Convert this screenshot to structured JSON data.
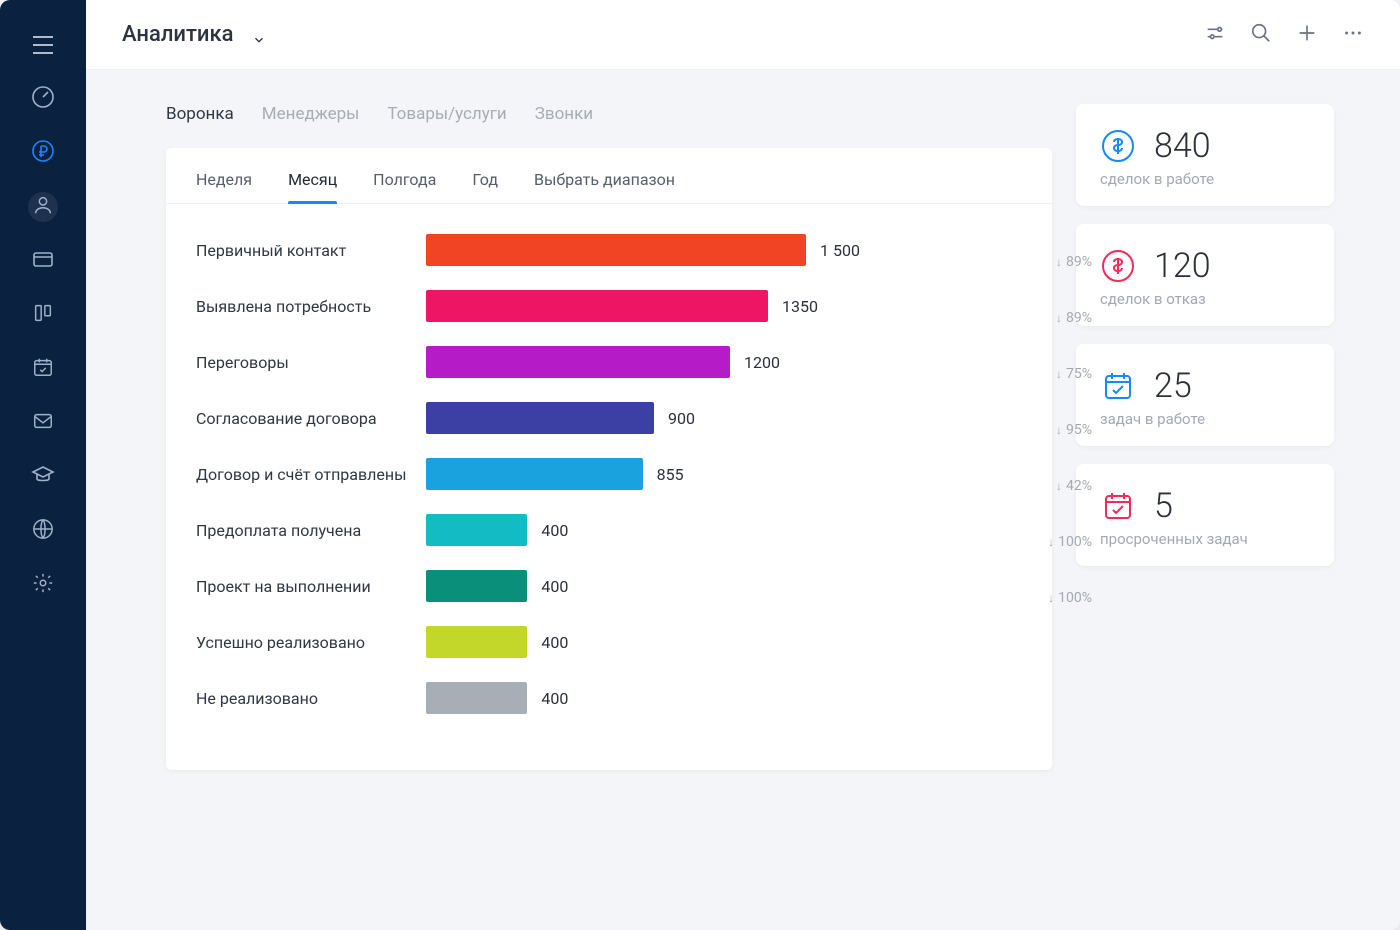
{
  "page_title": "Аналитика",
  "top_tabs": [
    "Воронка",
    "Менеджеры",
    "Товары/услуги",
    "Звонки"
  ],
  "top_tab_active": 0,
  "period_tabs": [
    "Неделя",
    "Месяц",
    "Полгода",
    "Год",
    "Выбрать диапазон"
  ],
  "period_tab_active": 1,
  "chart_data": {
    "type": "bar",
    "title": "",
    "xlabel": "",
    "ylabel": "",
    "max_value": 1500,
    "series": [
      {
        "name": "Первичный контакт",
        "value": 1500,
        "value_label": "1 500",
        "color": "#f14425",
        "drop_pct": "89%"
      },
      {
        "name": "Выявлена потребность",
        "value": 1350,
        "value_label": "1350",
        "color": "#ee1565",
        "drop_pct": "89%"
      },
      {
        "name": "Переговоры",
        "value": 1200,
        "value_label": "1200",
        "color": "#b51cc7",
        "drop_pct": "75%"
      },
      {
        "name": "Согласование договора",
        "value": 900,
        "value_label": "900",
        "color": "#3c3fa4",
        "drop_pct": "95%"
      },
      {
        "name": "Договор и счёт отправлены",
        "value": 855,
        "value_label": "855",
        "color": "#1aa2df",
        "drop_pct": "42%"
      },
      {
        "name": "Предоплата получена",
        "value": 400,
        "value_label": "400",
        "color": "#13bcc5",
        "drop_pct": "100%"
      },
      {
        "name": "Проект на выполнении",
        "value": 400,
        "value_label": "400",
        "color": "#0a8f7b",
        "drop_pct": "100%"
      },
      {
        "name": "Успешно реализовано",
        "value": 400,
        "value_label": "400",
        "color": "#c3d62a",
        "drop_pct": null
      },
      {
        "name": "Не реализовано",
        "value": 400,
        "value_label": "400",
        "color": "#a7aeb6",
        "drop_pct": null
      }
    ]
  },
  "stats": [
    {
      "icon": "dollar",
      "color": "#1588ff",
      "value": "840",
      "label": "сделок в работе"
    },
    {
      "icon": "dollar",
      "color": "#f42a5b",
      "value": "120",
      "label": "сделок в отказ"
    },
    {
      "icon": "calendar-check",
      "color": "#1588ff",
      "value": "25",
      "label": "задач в работе"
    },
    {
      "icon": "calendar-check",
      "color": "#f42a5b",
      "value": "5",
      "label": "просроченных задач"
    }
  ]
}
